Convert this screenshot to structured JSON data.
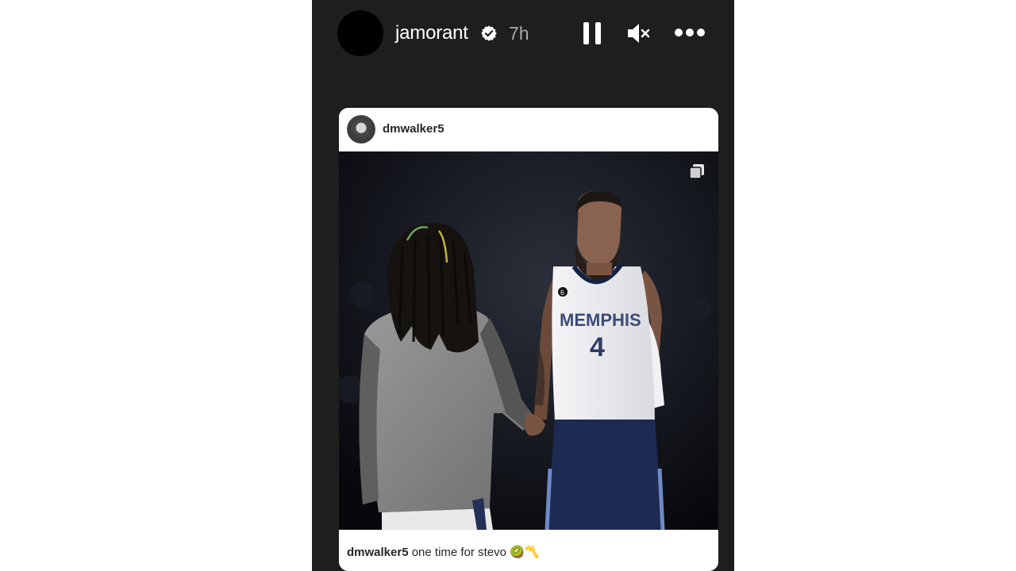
{
  "story": {
    "username": "jamorant",
    "time": "7h",
    "icons": {
      "verified": "verified-badge-icon",
      "pause": "pause-icon",
      "mute": "speaker-muted-icon",
      "more": "more-dots-icon"
    }
  },
  "shared_post": {
    "username": "dmwalker5",
    "jersey_text": "MEMPHIS",
    "jersey_number": "4",
    "patch_number": "6",
    "caption_user": "dmwalker5",
    "caption_text": " one time for stevo ",
    "caption_emoji": "🥝〽️",
    "icons": {
      "multi": "carousel-multiple-icon"
    }
  },
  "colors": {
    "story_bg": "#1e1e1e",
    "card_bg": "#ffffff",
    "text_secondary": "#a8a8a8"
  }
}
